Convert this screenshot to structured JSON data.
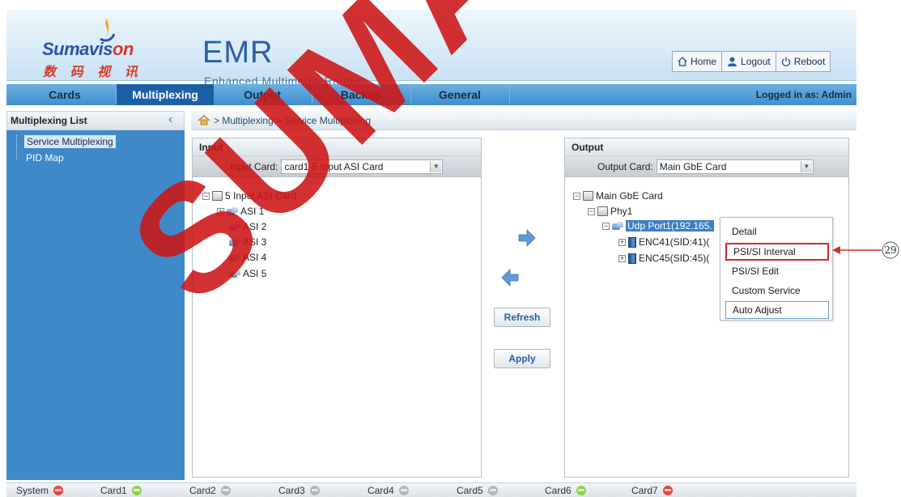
{
  "header": {
    "brand_en_a": "Sumavis",
    "brand_en_b": "on",
    "brand_cn": "数 码 视 讯",
    "product": "EMR",
    "product_sub": "Enhanced Multimedia Router",
    "buttons": [
      {
        "label": "Home",
        "icon": "home-icon"
      },
      {
        "label": "Logout",
        "icon": "user-icon"
      },
      {
        "label": "Reboot",
        "icon": "power-icon"
      }
    ]
  },
  "nav": {
    "tabs": [
      "Cards",
      "Multiplexing",
      "Output",
      "Backup",
      "General"
    ],
    "active": "Multiplexing",
    "logged_in": "Logged in as: Admin"
  },
  "sidebar": {
    "title": "Multiplexing List",
    "items": [
      "Service Multiplexing",
      "PID Map"
    ]
  },
  "breadcrumb": "> Multiplexing > Service Multiplexing",
  "input_panel": {
    "title": "Input",
    "card_label": "Input Card:",
    "card_value": "card1-5 Input ASI Card",
    "root": "5 Input ASI Card",
    "children": [
      "ASI 1",
      "ASI 2",
      "ASI 3",
      "ASI 4",
      "ASI 5"
    ]
  },
  "output_panel": {
    "title": "Output",
    "card_label": "Output Card:",
    "card_value": "Main GbE Card",
    "root": "Main GbE Card",
    "phy": "Phy1",
    "port": "Udp Port1(192.165.",
    "services": [
      "ENC41(SID:41)(",
      "ENC45(SID:45)("
    ]
  },
  "actions": {
    "refresh": "Refresh",
    "apply": "Apply"
  },
  "context_menu": {
    "items": [
      "Detail",
      "PSI/SI Interval",
      "PSI/SI Edit",
      "Custom Service",
      "Auto Adjust"
    ],
    "highlighted": "PSI/SI Interval"
  },
  "callout": "29",
  "statusbar": [
    {
      "label": "System",
      "color": "#e8453c"
    },
    {
      "label": "Card1",
      "color": "#8fd14f"
    },
    {
      "label": "Card2",
      "color": "#b5b5b5"
    },
    {
      "label": "Card3",
      "color": "#b5b5b5"
    },
    {
      "label": "Card4",
      "color": "#b5b5b5"
    },
    {
      "label": "Card5",
      "color": "#b5b5b5"
    },
    {
      "label": "Card6",
      "color": "#8fd14f"
    },
    {
      "label": "Card7",
      "color": "#e8453c"
    }
  ],
  "watermark": "SUMAVISION",
  "colors": {
    "nav_active": "#1d5fa5",
    "sidebar": "#3f89c9",
    "highlight_box": "#d52b2b"
  }
}
